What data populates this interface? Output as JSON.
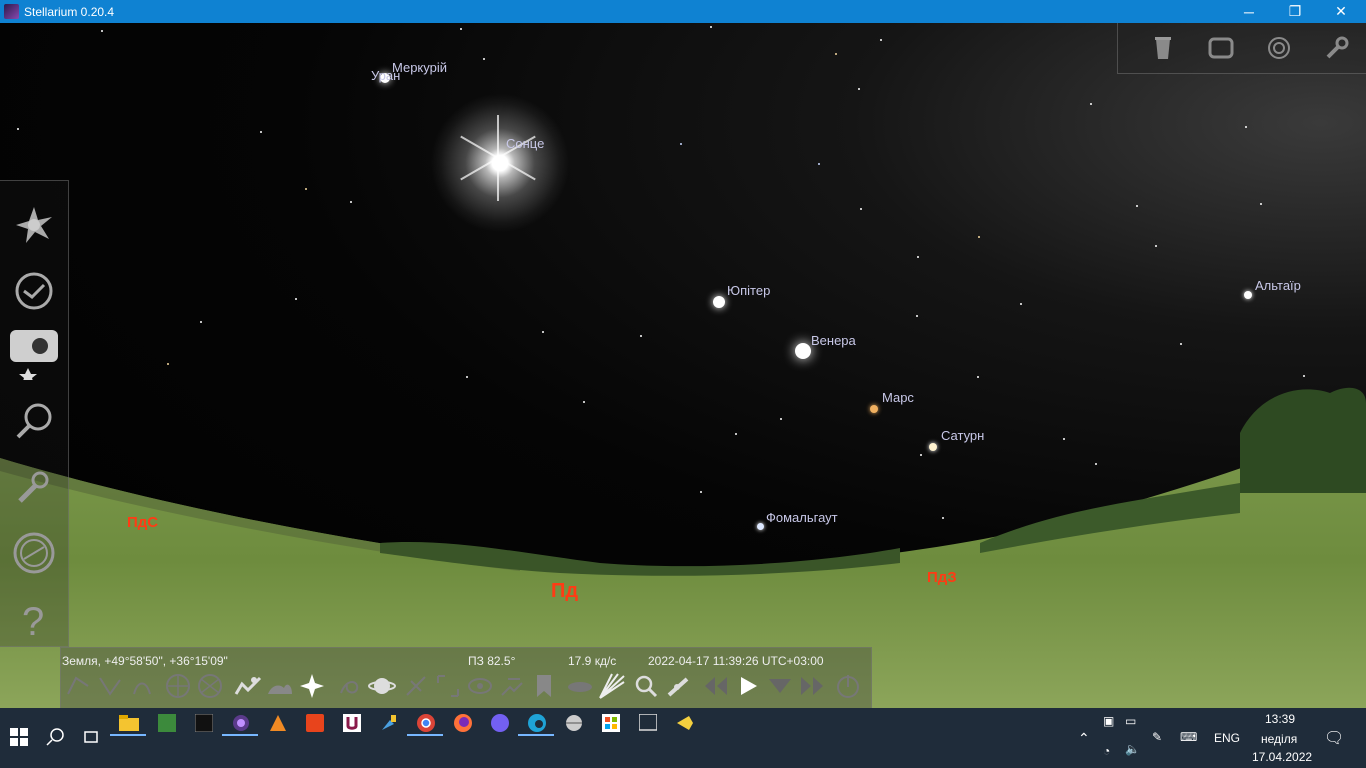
{
  "window": {
    "title": "Stellarium 0.20.4",
    "minimize": "─",
    "restore": "❐",
    "close": "✕"
  },
  "sky_labels": {
    "mercury": "Меркурій",
    "uranus": "Уран",
    "sun": "Сонце",
    "jupiter": "Юпітер",
    "venus": "Венера",
    "mars": "Марс",
    "saturn": "Сатурн",
    "fomalhaut": "Фомальгаут",
    "altair": "Альтаїр"
  },
  "cardinals": {
    "south_east": "ПдС",
    "south": "Пд",
    "south_west": "ПдЗ"
  },
  "status_bar": {
    "location": "Земля, +49°58'50\", +36°15'09\"",
    "fov": "ПЗ 82.5°",
    "fps": "17.9 кд/с",
    "datetime": "2022-04-17 11:39:26 UTC+03:00"
  },
  "left_panel": [
    "sky-and-viewing-icon",
    "date-time-icon",
    "sky-view-icon",
    "search-icon",
    "configuration-icon",
    "astro-calc-icon",
    "help-icon"
  ],
  "top_panel": [
    "bin-icon",
    "window-icon",
    "target-icon",
    "wrench-icon"
  ],
  "taskbar": {
    "language": "ENG",
    "time": "13:39",
    "day": "неділя",
    "date": "17.04.2022"
  }
}
